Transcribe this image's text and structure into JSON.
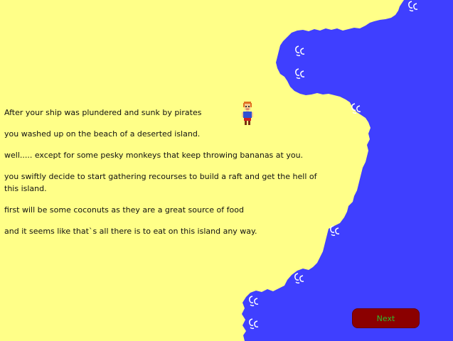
{
  "story": {
    "lines": [
      "After your ship was plundered and sunk by pirates",
      "you washed up on the beach of a deserted island.",
      "well..... except for some pesky monkeys that keep throwing bananas at you.",
      "you swiftly decide to start gathering recourses to build a raft and get the hell of this island.",
      "first will be some coconuts as they are a great source of food",
      "and it seems like that`s all there is to eat on this island any way."
    ]
  },
  "buttons": {
    "next_label": "Next"
  },
  "colors": {
    "sand": "#FFFF88",
    "sea": "#3F3FFF",
    "wave": "#FFFFFF",
    "button_bg": "#8B0000",
    "button_text": "#2EBD2E"
  },
  "icons": {
    "wave": "wave-icon",
    "character": "castaway-character-icon"
  }
}
